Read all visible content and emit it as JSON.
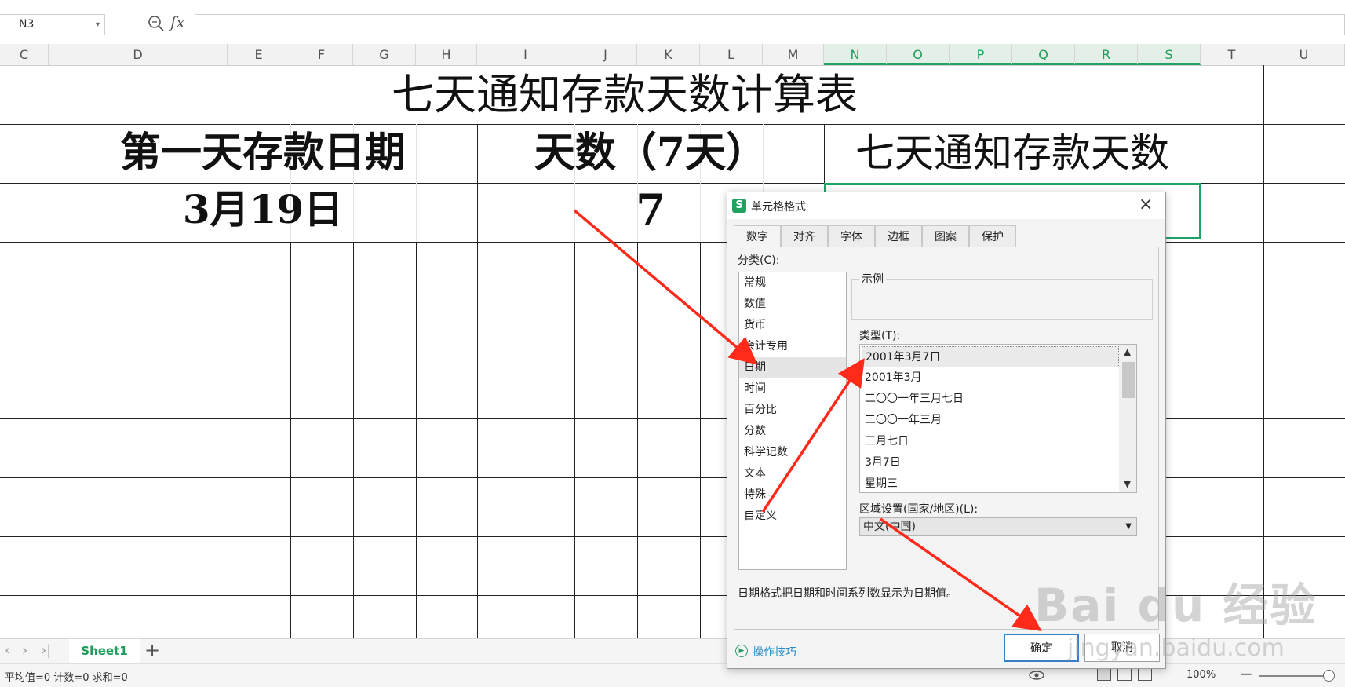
{
  "formula_bar": {
    "name_box": "N3",
    "fx_label": "fx",
    "formula_value": ""
  },
  "columns": [
    {
      "label": "C"
    },
    {
      "label": "D"
    },
    {
      "label": "E"
    },
    {
      "label": "F"
    },
    {
      "label": "G"
    },
    {
      "label": "H"
    },
    {
      "label": "I"
    },
    {
      "label": "J"
    },
    {
      "label": "K"
    },
    {
      "label": "L"
    },
    {
      "label": "M"
    },
    {
      "label": "N"
    },
    {
      "label": "O"
    },
    {
      "label": "P"
    },
    {
      "label": "Q"
    },
    {
      "label": "R"
    },
    {
      "label": "S"
    },
    {
      "label": "T"
    },
    {
      "label": "U"
    }
  ],
  "selected_columns": [
    "N",
    "O",
    "P",
    "Q",
    "R",
    "S"
  ],
  "sheet": {
    "title": "七天通知存款天数计算表",
    "header_start_date": "第一天存款日期",
    "header_days": "天数（7天）",
    "header_notice_days": "七天通知存款天数",
    "value_start_date": "3月19日",
    "value_days": "7"
  },
  "tabs_bar": {
    "sheet_name": "Sheet1",
    "add_sheet": "+"
  },
  "status_bar": {
    "summary": "平均值=0  计数=0  求和=0",
    "zoom": "100%"
  },
  "dialog": {
    "logo": "S",
    "title": "单元格格式",
    "close": "×",
    "tabs": [
      "数字",
      "对齐",
      "字体",
      "边框",
      "图案",
      "保护"
    ],
    "active_tab": "数字",
    "category_label": "分类(C):",
    "categories": [
      "常规",
      "数值",
      "货币",
      "会计专用",
      "日期",
      "时间",
      "百分比",
      "分数",
      "科学记数",
      "文本",
      "特殊",
      "自定义"
    ],
    "selected_category": "日期",
    "sample_label": "示例",
    "type_label": "类型(T):",
    "types": [
      "2001年3月7日",
      "2001年3月",
      "二〇〇一年三月七日",
      "二〇〇一年三月",
      "三月七日",
      "3月7日",
      "星期三"
    ],
    "selected_type": "2001年3月7日",
    "locale_label": "区域设置(国家/地区)(L):",
    "locale_value": "中文(中国)",
    "description": "日期格式把日期和时间系列数显示为日期值。",
    "tips_link": "操作技巧",
    "ok_label": "确定",
    "cancel_label": "取消"
  },
  "watermark": {
    "brand": "Bai du 经验",
    "url": "jingyan.baidu.com"
  },
  "colors": {
    "accent_green": "#21a366",
    "annotation_red": "#ff2a1a",
    "link_blue": "#2a8cc6"
  }
}
